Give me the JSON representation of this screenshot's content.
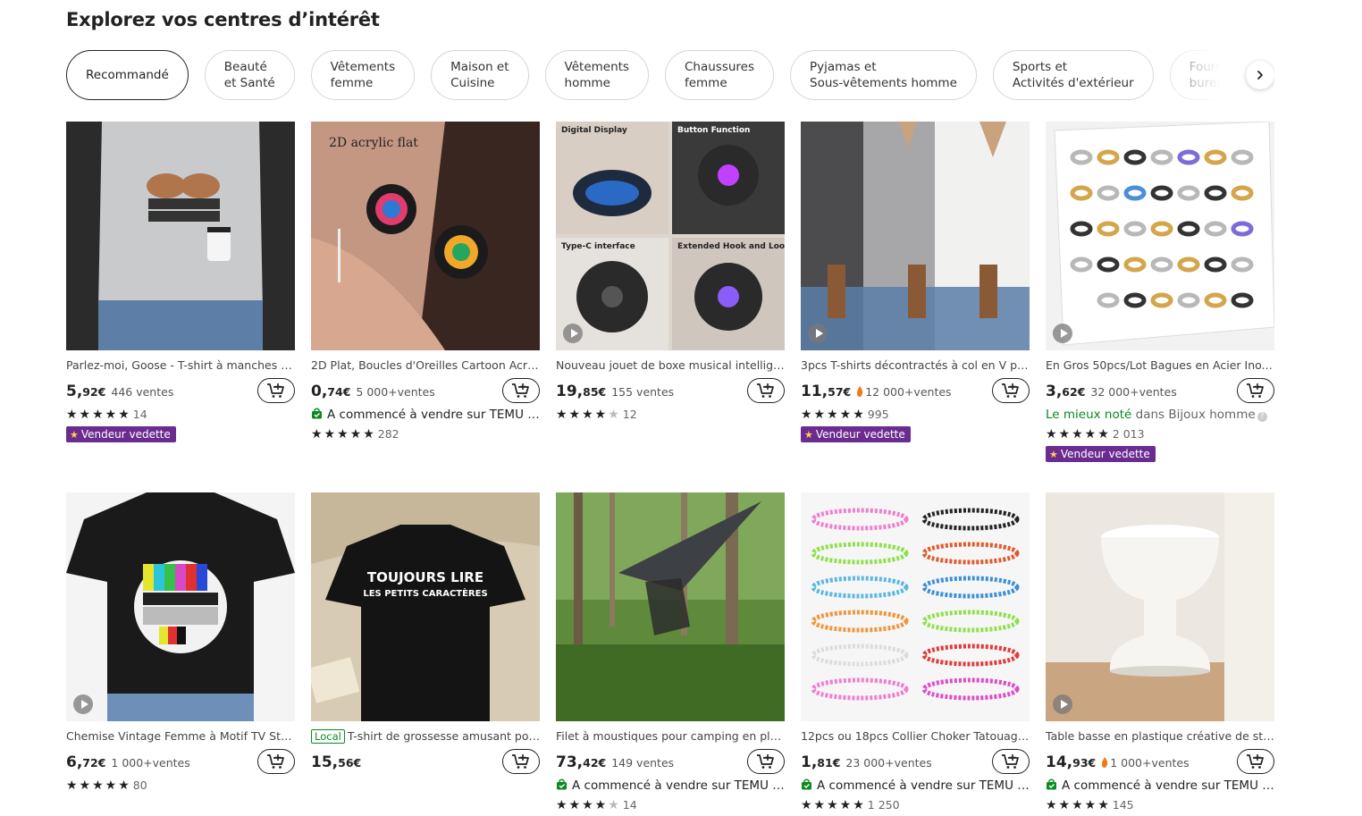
{
  "title": "Explorez vos centres d’intérêt",
  "chips": [
    {
      "l1": "Recommandé",
      "l2": ""
    },
    {
      "l1": "Beauté",
      "l2": "et Santé"
    },
    {
      "l1": "Vêtements",
      "l2": "femme"
    },
    {
      "l1": "Maison et",
      "l2": "Cuisine"
    },
    {
      "l1": "Vêtements",
      "l2": "homme"
    },
    {
      "l1": "Chaussures",
      "l2": "femme"
    },
    {
      "l1": "Pyjamas et",
      "l2": "Sous-vêtements homme"
    },
    {
      "l1": "Sports et",
      "l2": "Activités d'extérieur"
    },
    {
      "l1": "Fournitures de",
      "l2": "bureau"
    }
  ],
  "products": [
    {
      "title": "Parlez-moi, Goose - T-shirt à manches longues",
      "price_int": "5,",
      "price_dec": "92€",
      "sales": "446 ventes",
      "flame": false,
      "stars": "★★★★★",
      "empty_stars": "",
      "rating_count": "14",
      "news": "",
      "best_label": "",
      "best_rest": "",
      "badge": "Vendeur vedette",
      "local": ""
    },
    {
      "title": "2D Plat, Boucles d'Oreilles Cartoon Acrylique",
      "price_int": "0,",
      "price_dec": "74€",
      "sales": "5 000+ventes",
      "flame": false,
      "stars": "★★★★★",
      "empty_stars": "",
      "rating_count": "282",
      "news": "A commencé à vendre sur TEMU il y a",
      "best_label": "",
      "best_rest": "",
      "badge": "",
      "local": ""
    },
    {
      "title": "Nouveau jouet de boxe musical intelligent",
      "price_int": "19,",
      "price_dec": "85€",
      "sales": "155 ventes",
      "flame": false,
      "stars": "★★★★",
      "empty_stars": "★",
      "rating_count": "12",
      "news": "",
      "best_label": "",
      "best_rest": "",
      "badge": "",
      "local": ""
    },
    {
      "title": "3pcs T-shirts décontractés à col en V pour femme",
      "price_int": "11,",
      "price_dec": "57€",
      "sales": "12 000+ventes",
      "flame": true,
      "stars": "★★★★★",
      "empty_stars": "",
      "rating_count": "995",
      "news": "",
      "best_label": "",
      "best_rest": "",
      "badge": "Vendeur vedette",
      "local": ""
    },
    {
      "title": "En Gros 50pcs/Lot Bagues en Acier Inoxydable",
      "price_int": "3,",
      "price_dec": "62€",
      "sales": "32 000+ventes",
      "flame": false,
      "stars": "★★★★★",
      "empty_stars": "",
      "rating_count": "2 013",
      "news": "",
      "best_label": "Le mieux noté",
      "best_rest": "dans Bijoux homme",
      "badge": "Vendeur vedette",
      "local": ""
    },
    {
      "title": "Chemise Vintage Femme à Motif TV Static",
      "price_int": "6,",
      "price_dec": "72€",
      "sales": "1 000+ventes",
      "flame": false,
      "stars": "★★★★★",
      "empty_stars": "",
      "rating_count": "80",
      "news": "",
      "best_label": "",
      "best_rest": "",
      "badge": "",
      "local": ""
    },
    {
      "title": "T-shirt de grossesse amusant pour femme",
      "price_int": "15,",
      "price_dec": "56€",
      "sales": "",
      "flame": false,
      "stars": "",
      "empty_stars": "",
      "rating_count": "",
      "news": "",
      "best_label": "",
      "best_rest": "",
      "badge": "",
      "local": "Local"
    },
    {
      "title": "Filet à moustiques pour camping en plein air",
      "price_int": "73,",
      "price_dec": "42€",
      "sales": "149 ventes",
      "flame": false,
      "stars": "★★★★",
      "empty_stars": "★",
      "rating_count": "14",
      "news": "A commencé à vendre sur TEMU il y a",
      "best_label": "",
      "best_rest": "",
      "badge": "",
      "local": ""
    },
    {
      "title": "12pcs ou 18pcs Collier Choker Tatouage Vintage",
      "price_int": "1,",
      "price_dec": "81€",
      "sales": "23 000+ventes",
      "flame": false,
      "stars": "★★★★★",
      "empty_stars": "",
      "rating_count": "1 250",
      "news": "A commencé à vendre sur TEMU il y a",
      "best_label": "",
      "best_rest": "",
      "badge": "",
      "local": ""
    },
    {
      "title": "Table basse en plastique créative de style",
      "price_int": "14,",
      "price_dec": "93€",
      "sales": "1 000+ventes",
      "flame": true,
      "stars": "★★★★★",
      "empty_stars": "",
      "rating_count": "145",
      "news": "A commencé à vendre sur TEMU il y a",
      "best_label": "",
      "best_rest": "",
      "badge": "",
      "local": ""
    }
  ]
}
